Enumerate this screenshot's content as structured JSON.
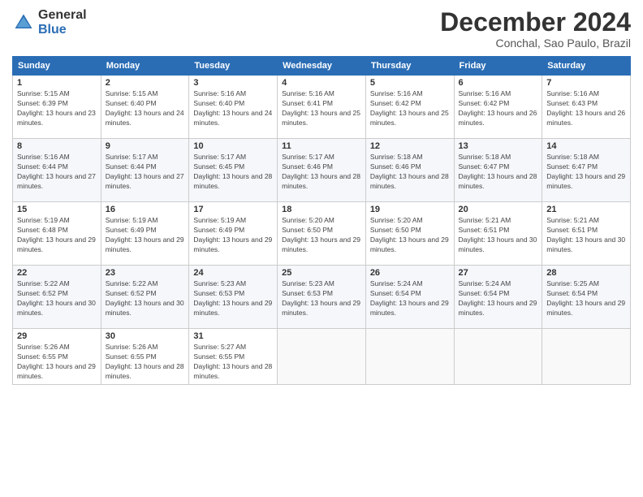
{
  "header": {
    "logo_general": "General",
    "logo_blue": "Blue",
    "month_title": "December 2024",
    "location": "Conchal, Sao Paulo, Brazil"
  },
  "weekdays": [
    "Sunday",
    "Monday",
    "Tuesday",
    "Wednesday",
    "Thursday",
    "Friday",
    "Saturday"
  ],
  "days": [
    {
      "date": "1",
      "sunrise": "5:15 AM",
      "sunset": "6:39 PM",
      "daylight": "13 hours and 23 minutes."
    },
    {
      "date": "2",
      "sunrise": "5:15 AM",
      "sunset": "6:40 PM",
      "daylight": "13 hours and 24 minutes."
    },
    {
      "date": "3",
      "sunrise": "5:16 AM",
      "sunset": "6:40 PM",
      "daylight": "13 hours and 24 minutes."
    },
    {
      "date": "4",
      "sunrise": "5:16 AM",
      "sunset": "6:41 PM",
      "daylight": "13 hours and 25 minutes."
    },
    {
      "date": "5",
      "sunrise": "5:16 AM",
      "sunset": "6:42 PM",
      "daylight": "13 hours and 25 minutes."
    },
    {
      "date": "6",
      "sunrise": "5:16 AM",
      "sunset": "6:42 PM",
      "daylight": "13 hours and 26 minutes."
    },
    {
      "date": "7",
      "sunrise": "5:16 AM",
      "sunset": "6:43 PM",
      "daylight": "13 hours and 26 minutes."
    },
    {
      "date": "8",
      "sunrise": "5:16 AM",
      "sunset": "6:44 PM",
      "daylight": "13 hours and 27 minutes."
    },
    {
      "date": "9",
      "sunrise": "5:17 AM",
      "sunset": "6:44 PM",
      "daylight": "13 hours and 27 minutes."
    },
    {
      "date": "10",
      "sunrise": "5:17 AM",
      "sunset": "6:45 PM",
      "daylight": "13 hours and 28 minutes."
    },
    {
      "date": "11",
      "sunrise": "5:17 AM",
      "sunset": "6:46 PM",
      "daylight": "13 hours and 28 minutes."
    },
    {
      "date": "12",
      "sunrise": "5:18 AM",
      "sunset": "6:46 PM",
      "daylight": "13 hours and 28 minutes."
    },
    {
      "date": "13",
      "sunrise": "5:18 AM",
      "sunset": "6:47 PM",
      "daylight": "13 hours and 28 minutes."
    },
    {
      "date": "14",
      "sunrise": "5:18 AM",
      "sunset": "6:47 PM",
      "daylight": "13 hours and 29 minutes."
    },
    {
      "date": "15",
      "sunrise": "5:19 AM",
      "sunset": "6:48 PM",
      "daylight": "13 hours and 29 minutes."
    },
    {
      "date": "16",
      "sunrise": "5:19 AM",
      "sunset": "6:49 PM",
      "daylight": "13 hours and 29 minutes."
    },
    {
      "date": "17",
      "sunrise": "5:19 AM",
      "sunset": "6:49 PM",
      "daylight": "13 hours and 29 minutes."
    },
    {
      "date": "18",
      "sunrise": "5:20 AM",
      "sunset": "6:50 PM",
      "daylight": "13 hours and 29 minutes."
    },
    {
      "date": "19",
      "sunrise": "5:20 AM",
      "sunset": "6:50 PM",
      "daylight": "13 hours and 29 minutes."
    },
    {
      "date": "20",
      "sunrise": "5:21 AM",
      "sunset": "6:51 PM",
      "daylight": "13 hours and 30 minutes."
    },
    {
      "date": "21",
      "sunrise": "5:21 AM",
      "sunset": "6:51 PM",
      "daylight": "13 hours and 30 minutes."
    },
    {
      "date": "22",
      "sunrise": "5:22 AM",
      "sunset": "6:52 PM",
      "daylight": "13 hours and 30 minutes."
    },
    {
      "date": "23",
      "sunrise": "5:22 AM",
      "sunset": "6:52 PM",
      "daylight": "13 hours and 30 minutes."
    },
    {
      "date": "24",
      "sunrise": "5:23 AM",
      "sunset": "6:53 PM",
      "daylight": "13 hours and 29 minutes."
    },
    {
      "date": "25",
      "sunrise": "5:23 AM",
      "sunset": "6:53 PM",
      "daylight": "13 hours and 29 minutes."
    },
    {
      "date": "26",
      "sunrise": "5:24 AM",
      "sunset": "6:54 PM",
      "daylight": "13 hours and 29 minutes."
    },
    {
      "date": "27",
      "sunrise": "5:24 AM",
      "sunset": "6:54 PM",
      "daylight": "13 hours and 29 minutes."
    },
    {
      "date": "28",
      "sunrise": "5:25 AM",
      "sunset": "6:54 PM",
      "daylight": "13 hours and 29 minutes."
    },
    {
      "date": "29",
      "sunrise": "5:26 AM",
      "sunset": "6:55 PM",
      "daylight": "13 hours and 29 minutes."
    },
    {
      "date": "30",
      "sunrise": "5:26 AM",
      "sunset": "6:55 PM",
      "daylight": "13 hours and 28 minutes."
    },
    {
      "date": "31",
      "sunrise": "5:27 AM",
      "sunset": "6:55 PM",
      "daylight": "13 hours and 28 minutes."
    }
  ]
}
